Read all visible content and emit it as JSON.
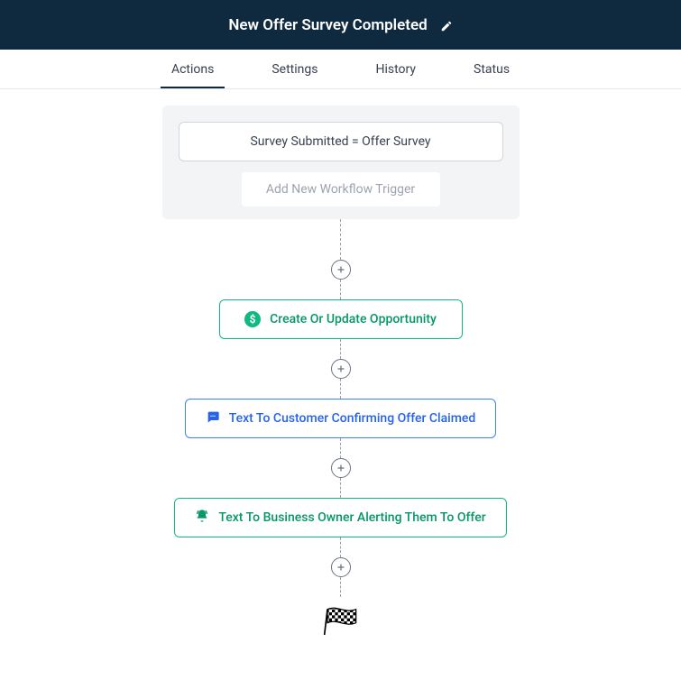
{
  "header": {
    "title": "New Offer Survey Completed"
  },
  "tabs": [
    {
      "label": "Actions",
      "active": true
    },
    {
      "label": "Settings",
      "active": false
    },
    {
      "label": "History",
      "active": false
    },
    {
      "label": "Status",
      "active": false
    }
  ],
  "triggers": {
    "items": [
      {
        "label": "Survey Submitted = Offer Survey"
      }
    ],
    "add_label": "Add New Workflow Trigger"
  },
  "actions": [
    {
      "label": "Create Or Update Opportunity",
      "color": "green",
      "icon": "dollar"
    },
    {
      "label": "Text To Customer Confirming Offer Claimed",
      "color": "blue",
      "icon": "chat"
    },
    {
      "label": "Text To Business Owner Alerting Them To Offer",
      "color": "green",
      "icon": "bell"
    }
  ]
}
